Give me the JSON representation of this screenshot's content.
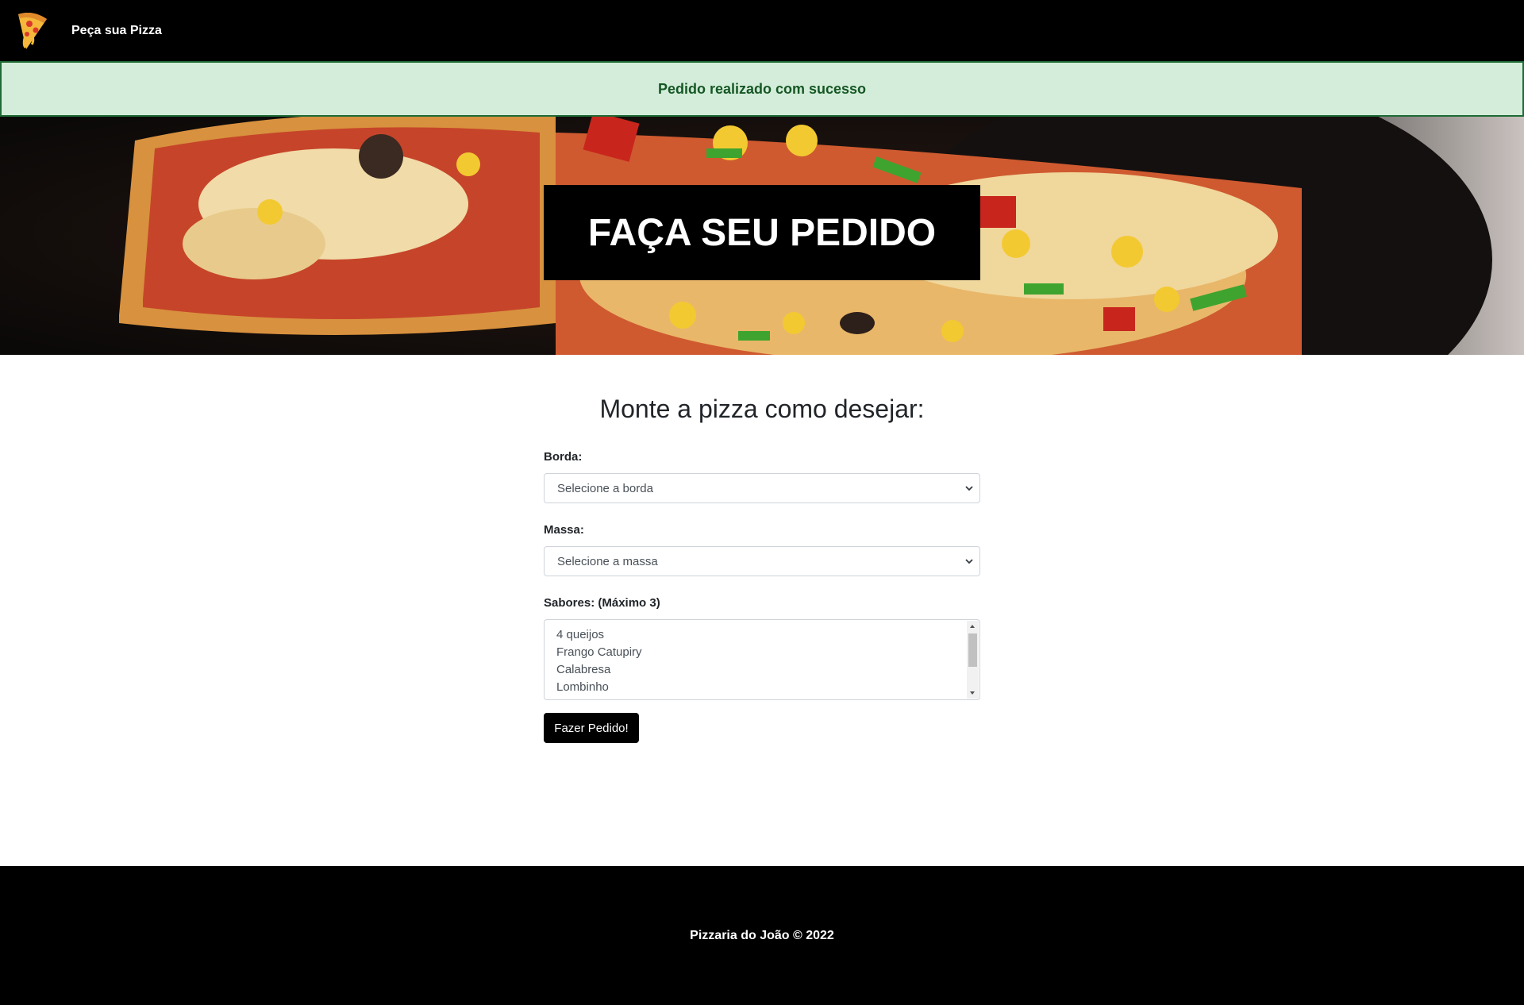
{
  "navbar": {
    "logo_icon": "pizza-slice-icon",
    "brand": "Peça sua Pizza"
  },
  "alert": {
    "message": "Pedido realizado com sucesso",
    "colors": {
      "background": "#d4edda",
      "border": "#1f6b35",
      "text": "#155724"
    }
  },
  "hero": {
    "title": "FAÇA SEU PEDIDO"
  },
  "form": {
    "heading": "Monte a pizza como desejar:",
    "borda": {
      "label": "Borda:",
      "selected": "Selecione a borda"
    },
    "massa": {
      "label": "Massa:",
      "selected": "Selecione a massa"
    },
    "sabores": {
      "label": "Sabores: (Máximo 3)",
      "options": [
        "4 queijos",
        "Frango Catupiry",
        "Calabresa",
        "Lombinho"
      ]
    },
    "submit_label": "Fazer Pedido!"
  },
  "footer": {
    "text": "Pizzaria do João © 2022"
  }
}
